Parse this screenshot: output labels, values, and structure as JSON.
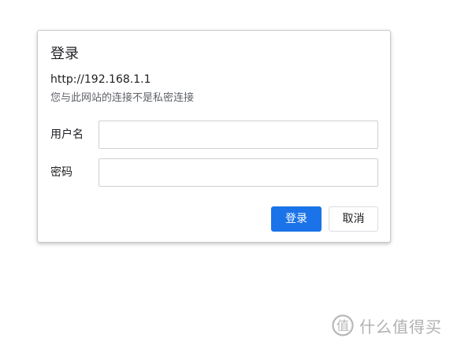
{
  "dialog": {
    "title": "登录",
    "url": "http://192.168.1.1",
    "warning": "您与此网站的连接不是私密连接",
    "username_label": "用户名",
    "username_value": "",
    "password_label": "密码",
    "password_value": "",
    "confirm_label": "登录",
    "cancel_label": "取消"
  },
  "watermark": {
    "logo_icon": "smzdm-logo-icon",
    "text": "什么值得买"
  },
  "colors": {
    "primary_button": "#1a73e8",
    "background": "#ffffff",
    "watermark": "#b0b0b0"
  }
}
